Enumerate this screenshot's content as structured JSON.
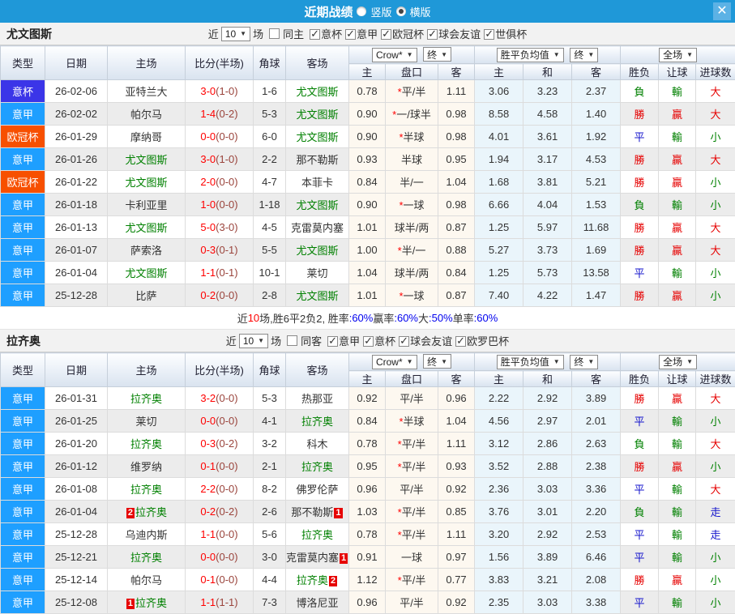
{
  "titlebar": {
    "title": "近期战绩",
    "radio_vertical": "竖版",
    "radio_horizontal": "横版",
    "selected_layout": "横版",
    "close_icon": "✕"
  },
  "colors": {
    "titlebar_blue": "#1F98D8",
    "close_button_blue": "#5CB2E5",
    "win_red": "#E60000",
    "lose_green": "#008000",
    "draw_blue": "#1414CC"
  },
  "league_colors": {
    "意杯": "#3B35E8",
    "意甲": "#1E9FFF",
    "欧冠杯": "#F75000"
  },
  "table_header": {
    "cols": [
      "类型",
      "日期",
      "主场",
      "比分(半场)",
      "角球",
      "客场"
    ],
    "odds_group": {
      "bookmaker": "Crow*",
      "period": "终",
      "sub": [
        "主",
        "盘口",
        "客"
      ]
    },
    "mean_group": {
      "name": "胜平负均值",
      "period": "终",
      "sub": [
        "主",
        "和",
        "客"
      ]
    },
    "result_group": {
      "name": "全场",
      "sub": [
        "胜负",
        "让球",
        "进球数"
      ]
    }
  },
  "sections": [
    {
      "team": "尤文图斯",
      "filter": {
        "near_label": "近",
        "count": "10",
        "unit": "场",
        "same_label": "同主",
        "same_checked": false,
        "leagues": [
          {
            "label": "意杯",
            "checked": true
          },
          {
            "label": "意甲",
            "checked": true
          },
          {
            "label": "欧冠杯",
            "checked": true
          },
          {
            "label": "球会友谊",
            "checked": true
          },
          {
            "label": "世俱杯",
            "checked": true
          }
        ]
      },
      "rows": [
        {
          "type": "意杯",
          "date": "26-02-06",
          "home": {
            "name": "亚特兰大"
          },
          "score": {
            "ft": "3-0",
            "ht": "(1-0)"
          },
          "corners": "1-6",
          "away": {
            "name": "尤文图斯",
            "green": true
          },
          "odds": [
            "0.78",
            "*平/半",
            "1.11"
          ],
          "mean": [
            "3.06",
            "3.23",
            "2.37"
          ],
          "results": [
            {
              "text": "負",
              "color": "green"
            },
            {
              "text": "輸",
              "color": "green"
            },
            {
              "text": "大",
              "color": "red"
            }
          ]
        },
        {
          "type": "意甲",
          "date": "26-02-02",
          "home": {
            "name": "帕尔马"
          },
          "score": {
            "ft": "1-4",
            "ht": "(0-2)"
          },
          "corners": "5-3",
          "away": {
            "name": "尤文图斯",
            "green": true
          },
          "odds": [
            "0.90",
            "*一/球半",
            "0.98"
          ],
          "mean": [
            "8.58",
            "4.58",
            "1.40"
          ],
          "results": [
            {
              "text": "勝",
              "color": "red"
            },
            {
              "text": "贏",
              "color": "red"
            },
            {
              "text": "大",
              "color": "red"
            }
          ]
        },
        {
          "type": "欧冠杯",
          "date": "26-01-29",
          "home": {
            "name": "摩纳哥"
          },
          "score": {
            "ft": "0-0",
            "ht": "(0-0)"
          },
          "corners": "6-0",
          "away": {
            "name": "尤文图斯",
            "green": true
          },
          "odds": [
            "0.90",
            "*半球",
            "0.98"
          ],
          "mean": [
            "4.01",
            "3.61",
            "1.92"
          ],
          "results": [
            {
              "text": "平",
              "color": "blue"
            },
            {
              "text": "輸",
              "color": "green"
            },
            {
              "text": "小",
              "color": "green"
            }
          ]
        },
        {
          "type": "意甲",
          "date": "26-01-26",
          "home": {
            "name": "尤文图斯",
            "green": true
          },
          "score": {
            "ft": "3-0",
            "ht": "(1-0)"
          },
          "corners": "2-2",
          "away": {
            "name": "那不勒斯"
          },
          "odds": [
            "0.93",
            "半球",
            "0.95"
          ],
          "mean": [
            "1.94",
            "3.17",
            "4.53"
          ],
          "results": [
            {
              "text": "勝",
              "color": "red"
            },
            {
              "text": "贏",
              "color": "red"
            },
            {
              "text": "大",
              "color": "red"
            }
          ]
        },
        {
          "type": "欧冠杯",
          "date": "26-01-22",
          "home": {
            "name": "尤文图斯",
            "green": true
          },
          "score": {
            "ft": "2-0",
            "ht": "(0-0)"
          },
          "corners": "4-7",
          "away": {
            "name": "本菲卡"
          },
          "odds": [
            "0.84",
            "半/一",
            "1.04"
          ],
          "mean": [
            "1.68",
            "3.81",
            "5.21"
          ],
          "results": [
            {
              "text": "勝",
              "color": "red"
            },
            {
              "text": "贏",
              "color": "red"
            },
            {
              "text": "小",
              "color": "green"
            }
          ]
        },
        {
          "type": "意甲",
          "date": "26-01-18",
          "home": {
            "name": "卡利亚里"
          },
          "score": {
            "ft": "1-0",
            "ht": "(0-0)"
          },
          "corners": "1-18",
          "away": {
            "name": "尤文图斯",
            "green": true
          },
          "odds": [
            "0.90",
            "*一球",
            "0.98"
          ],
          "mean": [
            "6.66",
            "4.04",
            "1.53"
          ],
          "results": [
            {
              "text": "負",
              "color": "green"
            },
            {
              "text": "輸",
              "color": "green"
            },
            {
              "text": "小",
              "color": "green"
            }
          ]
        },
        {
          "type": "意甲",
          "date": "26-01-13",
          "home": {
            "name": "尤文图斯",
            "green": true
          },
          "score": {
            "ft": "5-0",
            "ht": "(3-0)"
          },
          "corners": "4-5",
          "away": {
            "name": "克雷莫内塞"
          },
          "odds": [
            "1.01",
            "球半/两",
            "0.87"
          ],
          "mean": [
            "1.25",
            "5.97",
            "11.68"
          ],
          "results": [
            {
              "text": "勝",
              "color": "red"
            },
            {
              "text": "贏",
              "color": "red"
            },
            {
              "text": "大",
              "color": "red"
            }
          ]
        },
        {
          "type": "意甲",
          "date": "26-01-07",
          "home": {
            "name": "萨索洛"
          },
          "score": {
            "ft": "0-3",
            "ht": "(0-1)"
          },
          "corners": "5-5",
          "away": {
            "name": "尤文图斯",
            "green": true
          },
          "odds": [
            "1.00",
            "*半/一",
            "0.88"
          ],
          "mean": [
            "5.27",
            "3.73",
            "1.69"
          ],
          "results": [
            {
              "text": "勝",
              "color": "red"
            },
            {
              "text": "贏",
              "color": "red"
            },
            {
              "text": "大",
              "color": "red"
            }
          ]
        },
        {
          "type": "意甲",
          "date": "26-01-04",
          "home": {
            "name": "尤文图斯",
            "green": true
          },
          "score": {
            "ft": "1-1",
            "ht": "(0-1)"
          },
          "corners": "10-1",
          "away": {
            "name": "莱切"
          },
          "odds": [
            "1.04",
            "球半/两",
            "0.84"
          ],
          "mean": [
            "1.25",
            "5.73",
            "13.58"
          ],
          "results": [
            {
              "text": "平",
              "color": "blue"
            },
            {
              "text": "輸",
              "color": "green"
            },
            {
              "text": "小",
              "color": "green"
            }
          ]
        },
        {
          "type": "意甲",
          "date": "25-12-28",
          "home": {
            "name": "比萨"
          },
          "score": {
            "ft": "0-2",
            "ht": "(0-0)"
          },
          "corners": "2-8",
          "away": {
            "name": "尤文图斯",
            "green": true
          },
          "odds": [
            "1.01",
            "*一球",
            "0.87"
          ],
          "mean": [
            "7.40",
            "4.22",
            "1.47"
          ],
          "results": [
            {
              "text": "勝",
              "color": "red"
            },
            {
              "text": "贏",
              "color": "red"
            },
            {
              "text": "小",
              "color": "green"
            }
          ]
        }
      ],
      "summary": {
        "segments": [
          {
            "text": "近",
            "color": "black"
          },
          {
            "text": "10",
            "color": "red"
          },
          {
            "text": "场,胜6平2负2, 胜率",
            "color": "black"
          },
          {
            "text": ":60%",
            "color": "blue"
          },
          {
            "text": " 赢率",
            "color": "black"
          },
          {
            "text": ":60%",
            "color": "blue"
          },
          {
            "text": " 大",
            "color": "black"
          },
          {
            "text": ":50%",
            "color": "blue"
          },
          {
            "text": " 单率",
            "color": "black"
          },
          {
            "text": ":60%",
            "color": "blue"
          }
        ]
      }
    },
    {
      "team": "拉齐奥",
      "filter": {
        "near_label": "近",
        "count": "10",
        "unit": "场",
        "same_label": "同客",
        "same_checked": false,
        "leagues": [
          {
            "label": "意甲",
            "checked": true
          },
          {
            "label": "意杯",
            "checked": true
          },
          {
            "label": "球会友谊",
            "checked": true
          },
          {
            "label": "欧罗巴杯",
            "checked": true
          }
        ]
      },
      "rows": [
        {
          "type": "意甲",
          "date": "26-01-31",
          "home": {
            "name": "拉齐奥",
            "green": true
          },
          "score": {
            "ft": "3-2",
            "ht": "(0-0)"
          },
          "corners": "5-3",
          "away": {
            "name": "热那亚"
          },
          "odds": [
            "0.92",
            "平/半",
            "0.96"
          ],
          "mean": [
            "2.22",
            "2.92",
            "3.89"
          ],
          "results": [
            {
              "text": "勝",
              "color": "red"
            },
            {
              "text": "贏",
              "color": "red"
            },
            {
              "text": "大",
              "color": "red"
            }
          ]
        },
        {
          "type": "意甲",
          "date": "26-01-25",
          "home": {
            "name": "莱切"
          },
          "score": {
            "ft": "0-0",
            "ht": "(0-0)"
          },
          "corners": "4-1",
          "away": {
            "name": "拉齐奥",
            "green": true
          },
          "odds": [
            "0.84",
            "*半球",
            "1.04"
          ],
          "mean": [
            "4.56",
            "2.97",
            "2.01"
          ],
          "results": [
            {
              "text": "平",
              "color": "blue"
            },
            {
              "text": "輸",
              "color": "green"
            },
            {
              "text": "小",
              "color": "green"
            }
          ]
        },
        {
          "type": "意甲",
          "date": "26-01-20",
          "home": {
            "name": "拉齐奥",
            "green": true
          },
          "score": {
            "ft": "0-3",
            "ht": "(0-2)"
          },
          "corners": "3-2",
          "away": {
            "name": "科木"
          },
          "odds": [
            "0.78",
            "*平/半",
            "1.11"
          ],
          "mean": [
            "3.12",
            "2.86",
            "2.63"
          ],
          "results": [
            {
              "text": "負",
              "color": "green"
            },
            {
              "text": "輸",
              "color": "green"
            },
            {
              "text": "大",
              "color": "red"
            }
          ]
        },
        {
          "type": "意甲",
          "date": "26-01-12",
          "home": {
            "name": "维罗纳"
          },
          "score": {
            "ft": "0-1",
            "ht": "(0-0)"
          },
          "corners": "2-1",
          "away": {
            "name": "拉齐奥",
            "green": true
          },
          "odds": [
            "0.95",
            "*平/半",
            "0.93"
          ],
          "mean": [
            "3.52",
            "2.88",
            "2.38"
          ],
          "results": [
            {
              "text": "勝",
              "color": "red"
            },
            {
              "text": "贏",
              "color": "red"
            },
            {
              "text": "小",
              "color": "green"
            }
          ]
        },
        {
          "type": "意甲",
          "date": "26-01-08",
          "home": {
            "name": "拉齐奥",
            "green": true
          },
          "score": {
            "ft": "2-2",
            "ht": "(0-0)"
          },
          "corners": "8-2",
          "away": {
            "name": "佛罗伦萨"
          },
          "odds": [
            "0.96",
            "平/半",
            "0.92"
          ],
          "mean": [
            "2.36",
            "3.03",
            "3.36"
          ],
          "results": [
            {
              "text": "平",
              "color": "blue"
            },
            {
              "text": "輸",
              "color": "green"
            },
            {
              "text": "大",
              "color": "red"
            }
          ]
        },
        {
          "type": "意甲",
          "date": "26-01-04",
          "home": {
            "name": "拉齐奥",
            "green": true,
            "badge_before": "2"
          },
          "score": {
            "ft": "0-2",
            "ht": "(0-2)"
          },
          "corners": "2-6",
          "away": {
            "name": "那不勒斯",
            "badge_after": "1"
          },
          "odds": [
            "1.03",
            "*平/半",
            "0.85"
          ],
          "mean": [
            "3.76",
            "3.01",
            "2.20"
          ],
          "results": [
            {
              "text": "負",
              "color": "green"
            },
            {
              "text": "輸",
              "color": "green"
            },
            {
              "text": "走",
              "color": "blue"
            }
          ]
        },
        {
          "type": "意甲",
          "date": "25-12-28",
          "home": {
            "name": "乌迪内斯"
          },
          "score": {
            "ft": "1-1",
            "ht": "(0-0)"
          },
          "corners": "5-6",
          "away": {
            "name": "拉齐奥",
            "green": true
          },
          "odds": [
            "0.78",
            "*平/半",
            "1.11"
          ],
          "mean": [
            "3.20",
            "2.92",
            "2.53"
          ],
          "results": [
            {
              "text": "平",
              "color": "blue"
            },
            {
              "text": "輸",
              "color": "green"
            },
            {
              "text": "走",
              "color": "blue"
            }
          ]
        },
        {
          "type": "意甲",
          "date": "25-12-21",
          "home": {
            "name": "拉齐奥",
            "green": true
          },
          "score": {
            "ft": "0-0",
            "ht": "(0-0)"
          },
          "corners": "3-0",
          "away": {
            "name": "克雷莫内塞",
            "badge_after": "1"
          },
          "odds": [
            "0.91",
            "一球",
            "0.97"
          ],
          "mean": [
            "1.56",
            "3.89",
            "6.46"
          ],
          "results": [
            {
              "text": "平",
              "color": "blue"
            },
            {
              "text": "輸",
              "color": "green"
            },
            {
              "text": "小",
              "color": "green"
            }
          ]
        },
        {
          "type": "意甲",
          "date": "25-12-14",
          "home": {
            "name": "帕尔马"
          },
          "score": {
            "ft": "0-1",
            "ht": "(0-0)"
          },
          "corners": "4-4",
          "away": {
            "name": "拉齐奥",
            "green": true,
            "badge_after": "2"
          },
          "odds": [
            "1.12",
            "*平/半",
            "0.77"
          ],
          "mean": [
            "3.83",
            "3.21",
            "2.08"
          ],
          "results": [
            {
              "text": "勝",
              "color": "red"
            },
            {
              "text": "贏",
              "color": "red"
            },
            {
              "text": "小",
              "color": "green"
            }
          ]
        },
        {
          "type": "意甲",
          "date": "25-12-08",
          "home": {
            "name": "拉齐奥",
            "green": true,
            "badge_before": "1"
          },
          "score": {
            "ft": "1-1",
            "ht": "(1-1)"
          },
          "corners": "7-3",
          "away": {
            "name": "博洛尼亚"
          },
          "odds": [
            "0.96",
            "平/半",
            "0.92"
          ],
          "mean": [
            "2.35",
            "3.03",
            "3.38"
          ],
          "results": [
            {
              "text": "平",
              "color": "blue"
            },
            {
              "text": "輸",
              "color": "green"
            },
            {
              "text": "小",
              "color": "green"
            }
          ]
        }
      ]
    }
  ]
}
